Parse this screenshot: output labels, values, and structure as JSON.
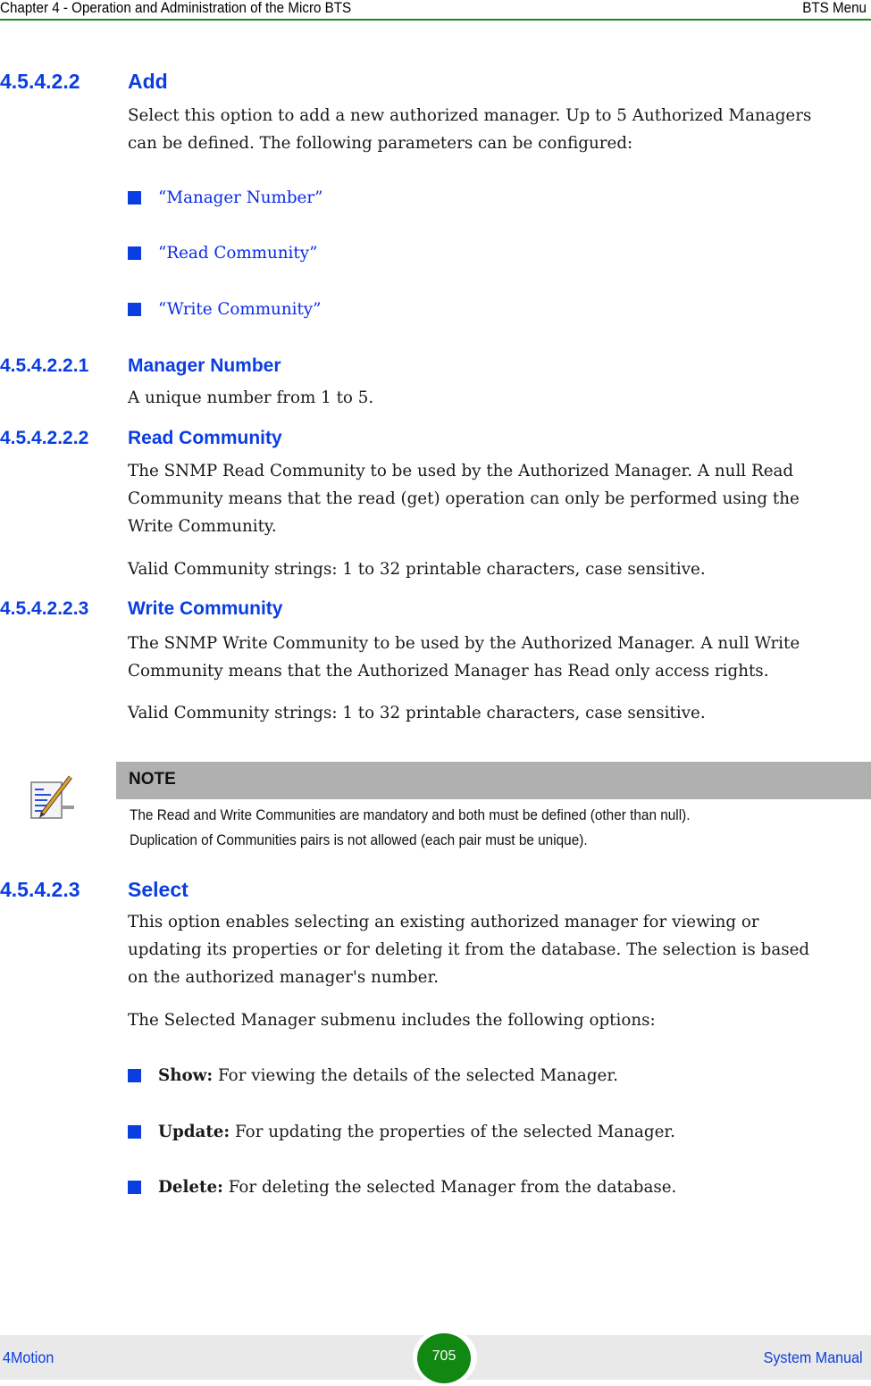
{
  "header": {
    "chapter": "Chapter 4 - Operation and Administration of the Micro BTS",
    "section": "BTS Menu"
  },
  "sections": {
    "add": {
      "number": "4.5.4.2.2",
      "title": "Add",
      "body_line1": "Select this option to add a new authorized manager. Up to 5 Authorized Managers",
      "body_line2": "can be defined. The following parameters can be configured:",
      "links": [
        "“Manager Number”",
        "“Read Community”",
        "“Write Community”"
      ]
    },
    "manager_number": {
      "number": "4.5.4.2.2.1",
      "title": "Manager Number",
      "body": "A unique number from 1 to 5."
    },
    "read_community": {
      "number": "4.5.4.2.2.2",
      "title": "Read Community",
      "body_line1": "The SNMP Read Community to be used by the Authorized Manager. A null Read",
      "body_line2": "Community means that the read (get) operation can only be performed using the",
      "body_line3": "Write Community.",
      "valid": "Valid Community strings: 1 to 32 printable characters, case sensitive."
    },
    "write_community": {
      "number": "4.5.4.2.2.3",
      "title": "Write Community",
      "body_line1": "The SNMP Write Community to be used by the Authorized Manager. A null Write",
      "body_line2": "Community means that the Authorized Manager has Read only access rights.",
      "valid": "Valid Community strings: 1 to 32 printable characters, case sensitive."
    },
    "note": {
      "icon": "note-pencil-icon",
      "title": "NOTE",
      "line1": "The Read and Write Communities are mandatory and both must be defined (other than null).",
      "line2": "Duplication of Communities pairs is not allowed (each pair must be unique)."
    },
    "select": {
      "number": "4.5.4.2.3",
      "title": "Select",
      "body_line1": "This option enables selecting an existing authorized manager for viewing or",
      "body_line2": "updating its properties or for deleting it from the database. The selection is based",
      "body_line3": "on the authorized manager's number.",
      "submenu_intro": "The Selected Manager submenu includes the following options:",
      "options": [
        {
          "label": "Show:",
          "desc": " For viewing the details of the selected Manager."
        },
        {
          "label": "Update:",
          "desc": " For updating the properties of the selected Manager."
        },
        {
          "label": "Delete:",
          "desc": " For deleting the selected Manager from the database."
        }
      ]
    }
  },
  "footer": {
    "product": "4Motion",
    "page": "705",
    "manual": "System Manual"
  },
  "colors": {
    "heading_blue": "#0a3ee0",
    "rule_green": "#1a8a1a",
    "page_badge_green": "#118811",
    "note_bar_gray": "#b0b0b0",
    "footer_gray": "#e9e9e9"
  }
}
